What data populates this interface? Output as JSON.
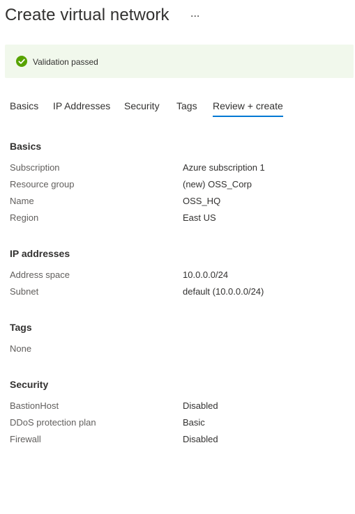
{
  "header": {
    "title": "Create virtual network",
    "more_label": "..."
  },
  "banner": {
    "icon": "check-circle-icon",
    "text": "Validation passed",
    "color": "#57a300",
    "bg": "#f1f8ec"
  },
  "tabs": [
    {
      "label": "Basics"
    },
    {
      "label": "IP Addresses"
    },
    {
      "label": "Security"
    },
    {
      "label": "Tags"
    },
    {
      "label": "Review + create",
      "active": true
    }
  ],
  "accent": "#0078d4",
  "sections": {
    "basics": {
      "title": "Basics",
      "rows": [
        {
          "label": "Subscription",
          "value": "Azure subscription 1"
        },
        {
          "label": "Resource group",
          "value": "(new) OSS_Corp"
        },
        {
          "label": "Name",
          "value": "OSS_HQ"
        },
        {
          "label": "Region",
          "value": "East US"
        }
      ]
    },
    "ip": {
      "title": "IP addresses",
      "rows": [
        {
          "label": "Address space",
          "value": "10.0.0.0/24"
        },
        {
          "label": "Subnet",
          "value": "default (10.0.0.0/24)"
        }
      ]
    },
    "tags": {
      "title": "Tags",
      "rows": [
        {
          "label": "None",
          "value": ""
        }
      ]
    },
    "security": {
      "title": "Security",
      "rows": [
        {
          "label": "BastionHost",
          "value": "Disabled"
        },
        {
          "label": "DDoS protection plan",
          "value": "Basic"
        },
        {
          "label": "Firewall",
          "value": "Disabled"
        }
      ]
    }
  }
}
